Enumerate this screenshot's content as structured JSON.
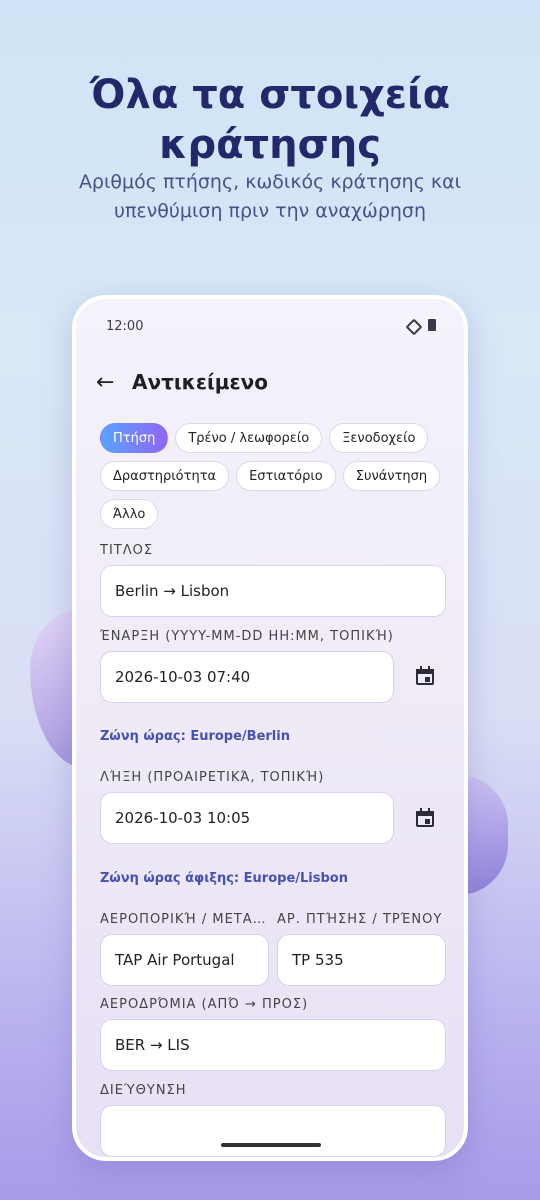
{
  "promo": {
    "headline_line1": "Όλα τα στοιχεία",
    "headline_line2": "κράτησης",
    "subline_line1": "Αριθμός πτήσης, κωδικός κράτησης και",
    "subline_line2": "υπενθύμιση πριν την αναχώρηση"
  },
  "status": {
    "time": "12:00"
  },
  "appbar": {
    "title": "Αντικείμενο"
  },
  "chips": [
    "Πτήση",
    "Τρένο / λεωφορείο",
    "Ξενοδοχείο",
    "Δραστηριότητα",
    "Εστιατόριο",
    "Συνάντηση",
    "Άλλο"
  ],
  "selected_chip": "Πτήση",
  "form": {
    "title_label": "ΤΙΤΛΟΣ",
    "title_value": "Berlin → Lisbon",
    "start_label": "ΈΝΑΡΞΗ (YYYY-MM-DD HH:MM, ΤΟΠΙΚΉ)",
    "start_value": "2026-10-03 07:40",
    "start_tz": "Ζώνη ώρας: Europe/Berlin",
    "end_label": "ΛΉΞΗ (ΠΡΟΑΙΡΕΤΙΚΆ, ΤΟΠΙΚΉ)",
    "end_value": "2026-10-03 10:05",
    "end_tz": "Ζώνη ώρας άφιξης: Europe/Lisbon",
    "airline_label": "ΑΕΡΟΠΟΡΙΚΉ / ΜΕΤΑ…",
    "airline_value": "TAP Air Portugal",
    "flight_label": "ΑΡ. ΠΤΉΣΗΣ / ΤΡΈΝΟΥ",
    "flight_value": "TP 535",
    "airports_label": "ΑΕΡΟΔΡΌΜΙΑ (ΑΠΌ → ΠΡΟΣ)",
    "airports_value": "BER → LIS",
    "address_label": "ΔΙΕΎΘΥΝΣΗ",
    "address_value": ""
  },
  "icons": {
    "back": "arrow-left-icon",
    "calendar": "calendar-icon",
    "signal": "signal-icon",
    "battery": "battery-icon"
  },
  "colors": {
    "accent_start": "#5aa2ff",
    "accent_end": "#8f66f2",
    "tz_text": "#4750b3",
    "headline": "#23286a"
  }
}
